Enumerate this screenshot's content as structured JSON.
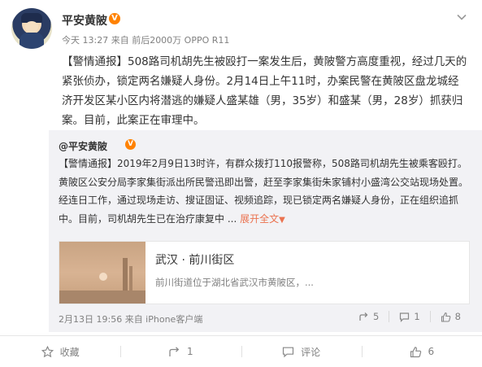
{
  "post": {
    "username": "平安黄陂",
    "verified_badge": "V",
    "meta": "今天 13:27 来自 前后2000万 OPPO R11",
    "tag": "【警情通报】",
    "text": "508路司机胡先生被殴打一案发生后，黄陂警方高度重视，经过几天的紧张侦办，锁定两名嫌疑人身份。2月14日上午11时，办案民警在黄陂区盘龙城经济开发区某小区内将潜逃的嫌疑人盛某雄（男，35岁）和盛某（男，28岁）抓获归案。目前，此案正在审理中。"
  },
  "repost": {
    "author": "@平安黄陂",
    "verified_badge": "V",
    "tag": "【警情通报】",
    "text": "2019年2月9日13时许，有群众拨打110报警称，508路司机胡先生被乘客殴打。黄陂区公安分局李家集街派出所民警迅即出警，赶至李家集街朱家铺村小盛湾公交站现场处置。经连日工作，通过现场走访、搜证固证、视频追踪，现已锁定两名嫌疑人身份，正在组织追抓中。目前，司机胡先生已在治疗康复中 ...",
    "more_label": "展开全文",
    "more_arrow": "▼",
    "link_card": {
      "title": "武汉 · 前川街区",
      "description": "前川街道位于湖北省武汉市黄陂区，..."
    },
    "footer_meta": "2月13日 19:56 来自 iPhone客户端",
    "actions": {
      "repost_count": "5",
      "comment_count": "1",
      "like_count": "8"
    }
  },
  "bottom_bar": {
    "favorite_label": "收藏",
    "repost_count": "1",
    "comment_label": "评论",
    "like_count": "6"
  },
  "colors": {
    "accent_orange": "#ff8200",
    "link_orange": "#eb7350",
    "repost_bg": "#f2f2f5",
    "meta_gray": "#808080"
  }
}
